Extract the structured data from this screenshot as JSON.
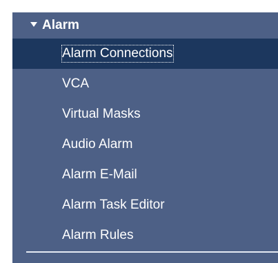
{
  "menu": {
    "section_title": "Alarm",
    "expand_icon": "triangle-down",
    "selected_index": 0,
    "items": [
      {
        "label": "Alarm Connections"
      },
      {
        "label": "VCA"
      },
      {
        "label": "Virtual Masks"
      },
      {
        "label": "Audio Alarm"
      },
      {
        "label": "Alarm E-Mail"
      },
      {
        "label": "Alarm Task Editor"
      },
      {
        "label": "Alarm Rules"
      }
    ]
  },
  "colors": {
    "panel_background": "#4d6086",
    "selected_background": "#1c375e",
    "text": "#ffffff"
  }
}
